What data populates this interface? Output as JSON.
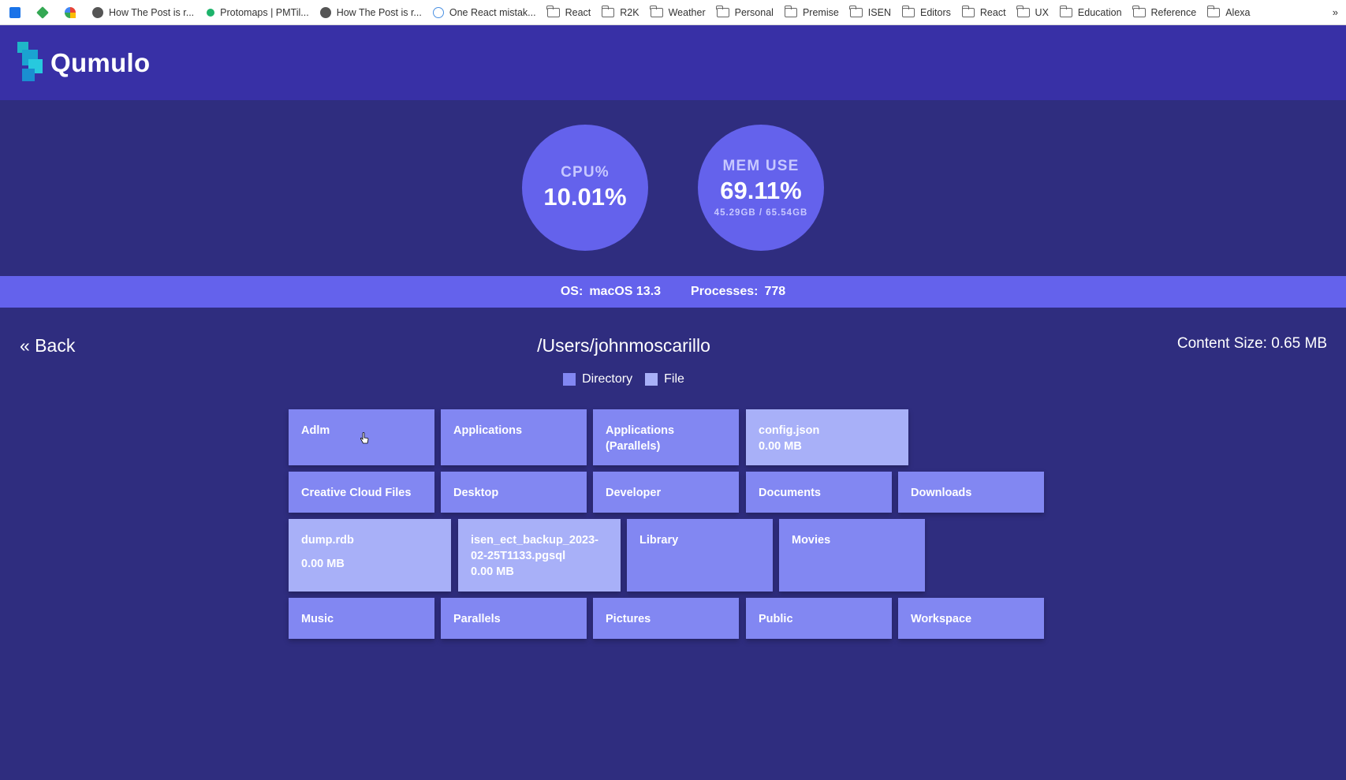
{
  "bookmarks_bar": {
    "items": [
      {
        "label": "",
        "icon": "calendar-icon"
      },
      {
        "label": "",
        "icon": "diamond-icon"
      },
      {
        "label": "",
        "icon": "fan-icon"
      },
      {
        "label": "How The Post is r...",
        "icon": "globe-icon"
      },
      {
        "label": "Protomaps | PMTil...",
        "icon": "dot-icon"
      },
      {
        "label": "How The Post is r...",
        "icon": "globe-icon"
      },
      {
        "label": "One React mistak...",
        "icon": "atom-icon"
      },
      {
        "label": "React",
        "icon": "folder-icon"
      },
      {
        "label": "R2K",
        "icon": "folder-icon"
      },
      {
        "label": "Weather",
        "icon": "folder-icon"
      },
      {
        "label": "Personal",
        "icon": "folder-icon"
      },
      {
        "label": "Premise",
        "icon": "folder-icon"
      },
      {
        "label": "ISEN",
        "icon": "folder-icon"
      },
      {
        "label": "Editors",
        "icon": "folder-icon"
      },
      {
        "label": "React",
        "icon": "folder-icon"
      },
      {
        "label": "UX",
        "icon": "folder-icon"
      },
      {
        "label": "Education",
        "icon": "folder-icon"
      },
      {
        "label": "Reference",
        "icon": "folder-icon"
      },
      {
        "label": "Alexa",
        "icon": "folder-icon"
      }
    ],
    "overflow": "»"
  },
  "header": {
    "brand": "Qumulo"
  },
  "stats": {
    "cpu": {
      "label": "CPU%",
      "value": "10.01%"
    },
    "mem": {
      "label": "MEM USE",
      "value": "69.11%",
      "detail": "45.29GB / 65.54GB"
    }
  },
  "info": {
    "os_label": "OS:",
    "os_value": "macOS 13.3",
    "proc_label": "Processes:",
    "proc_value": "778"
  },
  "nav": {
    "back": "« Back",
    "path": "/Users/johnmoscarillo",
    "content_size": "Content Size: 0.65 MB"
  },
  "legend": {
    "directory": "Directory",
    "file": "File"
  },
  "colors": {
    "background": "#2f2d7f",
    "header": "#3830a6",
    "accent": "#6462ec",
    "directory": "#8287f2",
    "file": "#a8b0f8"
  },
  "entries": [
    {
      "name": "Adlm",
      "type": "directory"
    },
    {
      "name": "Applications",
      "type": "directory"
    },
    {
      "name": "Applications (Parallels)",
      "type": "directory"
    },
    {
      "name": "config.json",
      "type": "file",
      "size": "0.00 MB"
    },
    {
      "name": "Creative Cloud Files",
      "type": "directory"
    },
    {
      "name": "Desktop",
      "type": "directory"
    },
    {
      "name": "Developer",
      "type": "directory"
    },
    {
      "name": "Documents",
      "type": "directory"
    },
    {
      "name": "Downloads",
      "type": "directory"
    },
    {
      "name": "dump.rdb",
      "type": "file",
      "size": "0.00 MB"
    },
    {
      "name": "isen_ect_backup_2023-02-25T1133.pgsql",
      "type": "file",
      "size": "0.00 MB"
    },
    {
      "name": "Library",
      "type": "directory"
    },
    {
      "name": "Movies",
      "type": "directory"
    },
    {
      "name": "Music",
      "type": "directory"
    },
    {
      "name": "Parallels",
      "type": "directory"
    },
    {
      "name": "Pictures",
      "type": "directory"
    },
    {
      "name": "Public",
      "type": "directory"
    },
    {
      "name": "Workspace",
      "type": "directory"
    }
  ]
}
